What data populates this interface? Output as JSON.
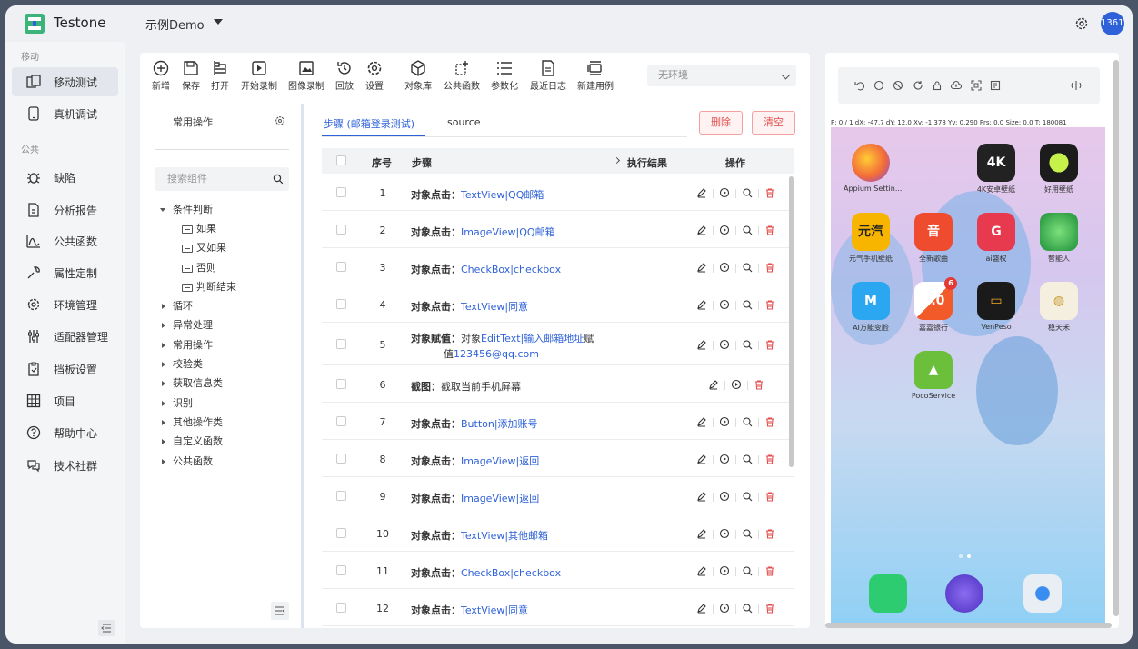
{
  "app": {
    "name": "Testone",
    "project": "示例Demo",
    "user": "13616"
  },
  "sidebar": {
    "groups": [
      {
        "label": "移动",
        "items": [
          {
            "label": "移动测试",
            "icon": "mobile-test-icon",
            "active": true
          },
          {
            "label": "真机调试",
            "icon": "phone-icon"
          }
        ]
      },
      {
        "label": "公共",
        "items": [
          {
            "label": "缺陷",
            "icon": "bug-icon"
          },
          {
            "label": "分析报告",
            "icon": "report-icon"
          },
          {
            "label": "公共函数",
            "icon": "function-icon"
          },
          {
            "label": "属性定制",
            "icon": "wrench-icon"
          },
          {
            "label": "环境管理",
            "icon": "gear-icon"
          },
          {
            "label": "适配器管理",
            "icon": "adapter-icon"
          },
          {
            "label": "挡板设置",
            "icon": "baffle-icon"
          },
          {
            "label": "项目",
            "icon": "grid-icon"
          },
          {
            "label": "帮助中心",
            "icon": "help-icon"
          },
          {
            "label": "技术社群",
            "icon": "community-icon"
          }
        ]
      }
    ]
  },
  "toolbar": {
    "items": [
      {
        "label": "新增",
        "icon": "plus-circle-icon"
      },
      {
        "label": "保存",
        "icon": "save-icon"
      },
      {
        "label": "打开",
        "icon": "open-icon"
      },
      {
        "label": "开始录制",
        "icon": "record-icon"
      },
      {
        "label": "图像录制",
        "icon": "image-record-icon"
      },
      {
        "label": "回放",
        "icon": "replay-icon"
      },
      {
        "label": "设置",
        "icon": "settings-icon"
      },
      {
        "label": "对象库",
        "icon": "cube-icon"
      },
      {
        "label": "公共函数",
        "icon": "public-function-icon"
      },
      {
        "label": "参数化",
        "icon": "list-icon"
      },
      {
        "label": "最近日志",
        "icon": "log-icon"
      },
      {
        "label": "新建用例",
        "icon": "new-case-icon"
      }
    ],
    "env": "无环境"
  },
  "components": {
    "title": "常用操作",
    "search_placeholder": "搜索组件",
    "tree": [
      {
        "label": "条件判断",
        "expanded": true,
        "children": [
          "如果",
          "又如果",
          "否则",
          "判断结束"
        ]
      },
      {
        "label": "循环"
      },
      {
        "label": "异常处理"
      },
      {
        "label": "常用操作"
      },
      {
        "label": "校验类"
      },
      {
        "label": "获取信息类"
      },
      {
        "label": "识别"
      },
      {
        "label": "其他操作类"
      },
      {
        "label": "自定义函数"
      },
      {
        "label": "公共函数"
      }
    ]
  },
  "steps": {
    "tabs": [
      "步骤 (邮箱登录测试)",
      "source"
    ],
    "delete_label": "删除",
    "clear_label": "清空",
    "headers": {
      "index": "序号",
      "step": "步骤",
      "result": "执行结果",
      "ops": "操作"
    },
    "rows": [
      {
        "index": "1",
        "action": "对象点击：",
        "target": "TextView|QQ邮箱"
      },
      {
        "index": "2",
        "action": "对象点击：",
        "target": "ImageView|QQ邮箱"
      },
      {
        "index": "3",
        "action": "对象点击：",
        "target": "CheckBox|checkbox"
      },
      {
        "index": "4",
        "action": "对象点击：",
        "target": "TextView|同意"
      },
      {
        "index": "5",
        "action": "对象赋值：",
        "l1a": "对象",
        "l1b": "EditText|输入邮箱地址",
        "l1c": "赋",
        "l2a": "值",
        "l2b": "123456@qq.com"
      },
      {
        "index": "6",
        "action": "截图：",
        "text": "截取当前手机屏幕"
      },
      {
        "index": "7",
        "action": "对象点击：",
        "target": "Button|添加账号"
      },
      {
        "index": "8",
        "action": "对象点击：",
        "target": "ImageView|返回"
      },
      {
        "index": "9",
        "action": "对象点击：",
        "target": "ImageView|返回"
      },
      {
        "index": "10",
        "action": "对象点击：",
        "target": "TextView|其他邮箱"
      },
      {
        "index": "11",
        "action": "对象点击：",
        "target": "CheckBox|checkbox"
      },
      {
        "index": "12",
        "action": "对象点击：",
        "target": "TextView|同意"
      }
    ]
  },
  "phone": {
    "status": "P: 0 / 1   dX: -47.7  dY: 12.0   Xv: -1.378  Yv: 0.290  Prs: 0.0  Size: 0.0   T: 180081",
    "apps": [
      {
        "label": "Appium Settin...",
        "color": "#f26b3a"
      },
      {
        "label": "4K安卓壁纸",
        "color": "#222222",
        "glyph": "4K"
      },
      {
        "label": "好用壁纸",
        "color": "#1c1c1c"
      },
      {
        "label": "元气手机壁纸",
        "color": "#f7b500",
        "glyph": "元汽"
      },
      {
        "label": "全新歌曲",
        "color": "#ef4b2e",
        "glyph": "音"
      },
      {
        "label": "ai盛权",
        "color": "#e83a4f"
      },
      {
        "label": "智能人",
        "color": "#33b24a"
      },
      {
        "label": "AI万能变脸",
        "color": "#2aa7f0"
      },
      {
        "label": "嘉嘉银行",
        "color": "#f25a2a",
        "badge": "6",
        "glyph": "4.0"
      },
      {
        "label": "VenPeso",
        "color": "#1a1a1a"
      },
      {
        "label": "稳天禾",
        "color": "#f5efe0"
      },
      {
        "label": "PocoService",
        "color": "#6cbf3a"
      }
    ]
  }
}
